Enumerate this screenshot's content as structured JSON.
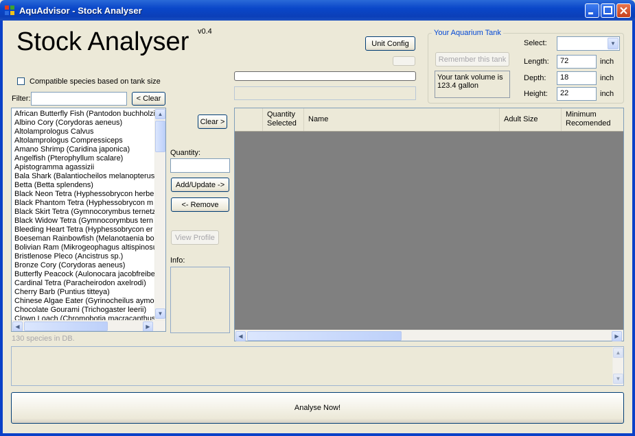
{
  "window": {
    "title": "AquAdvisor - Stock Analyser"
  },
  "header": {
    "app_title": "Stock Analyser",
    "version": "v0.4"
  },
  "toolbar": {
    "unit_config": "Unit Config"
  },
  "left": {
    "compatible_label": "Compatible species based on tank size",
    "filter_label": "Filter:",
    "filter_value": "",
    "clear_label": "< Clear",
    "species": [
      "African Butterfly Fish   (Pantodon buchholzi",
      "Albino Cory   (Corydoras aeneus)",
      "Altolamprologus Calvus",
      "Altolamprologus Compressiceps",
      "Amano Shrimp   (Caridina japonica)",
      "Angelfish   (Pterophyllum scalare)",
      "Apistogramma agassizii",
      "Bala Shark   (Balantiocheilos melanopterus",
      "Betta   (Betta splendens)",
      "Black Neon Tetra   (Hyphessobrycon herbe",
      "Black Phantom Tetra   (Hyphessobrycon m",
      "Black Skirt Tetra   (Gymnocorymbus ternetz",
      "Black Widow Tetra   (Gymnocorymbus tern",
      "Bleeding Heart Tetra   (Hyphessobrycon er",
      "Boeseman Rainbowfish   (Melanotaenia bo",
      "Bolivian Ram   (Mikrogeophagus altispinosu",
      "Bristlenose Pleco   (Ancistrus sp.)",
      "Bronze Cory   (Corydoras aeneus)",
      "Butterfly Peacock   (Aulonocara jacobfreibe",
      "Cardinal Tetra   (Paracheirodon axelrodi)",
      "Cherry Barb   (Puntius titteya)",
      "Chinese Algae Eater   (Gyrinocheilus aymor",
      "Chocolate Gourami   (Trichogaster leerii)",
      "Clown Loach   (Chromobotia macracanthus"
    ],
    "db_count": "130 species in DB."
  },
  "middle": {
    "clear_right": "Clear >",
    "quantity_label": "Quantity:",
    "quantity_value": "",
    "add_update": "Add/Update ->",
    "remove": "<- Remove",
    "view_profile": "View Profile",
    "info_label": "Info:"
  },
  "tank": {
    "group_title": "Your Aquarium Tank",
    "remember": "Remember this tank",
    "volume_line1": "Your tank volume is",
    "volume_line2": "123.4 gallon",
    "select_label": "Select:",
    "select_value": "",
    "length_label": "Length:",
    "length_value": "72",
    "depth_label": "Depth:",
    "depth_value": "18",
    "height_label": "Height:",
    "height_value": "22",
    "unit": "inch"
  },
  "grid": {
    "columns": [
      "",
      "Quantity Selected",
      "Name",
      "Adult Size",
      "Minimum Recomended"
    ]
  },
  "footer": {
    "analyse": "Analyse Now!"
  },
  "colors": {
    "titlebar": "#0a47c9",
    "window_bg": "#ece9d8",
    "grid_bg": "#808080",
    "group_title": "#0046d5"
  }
}
